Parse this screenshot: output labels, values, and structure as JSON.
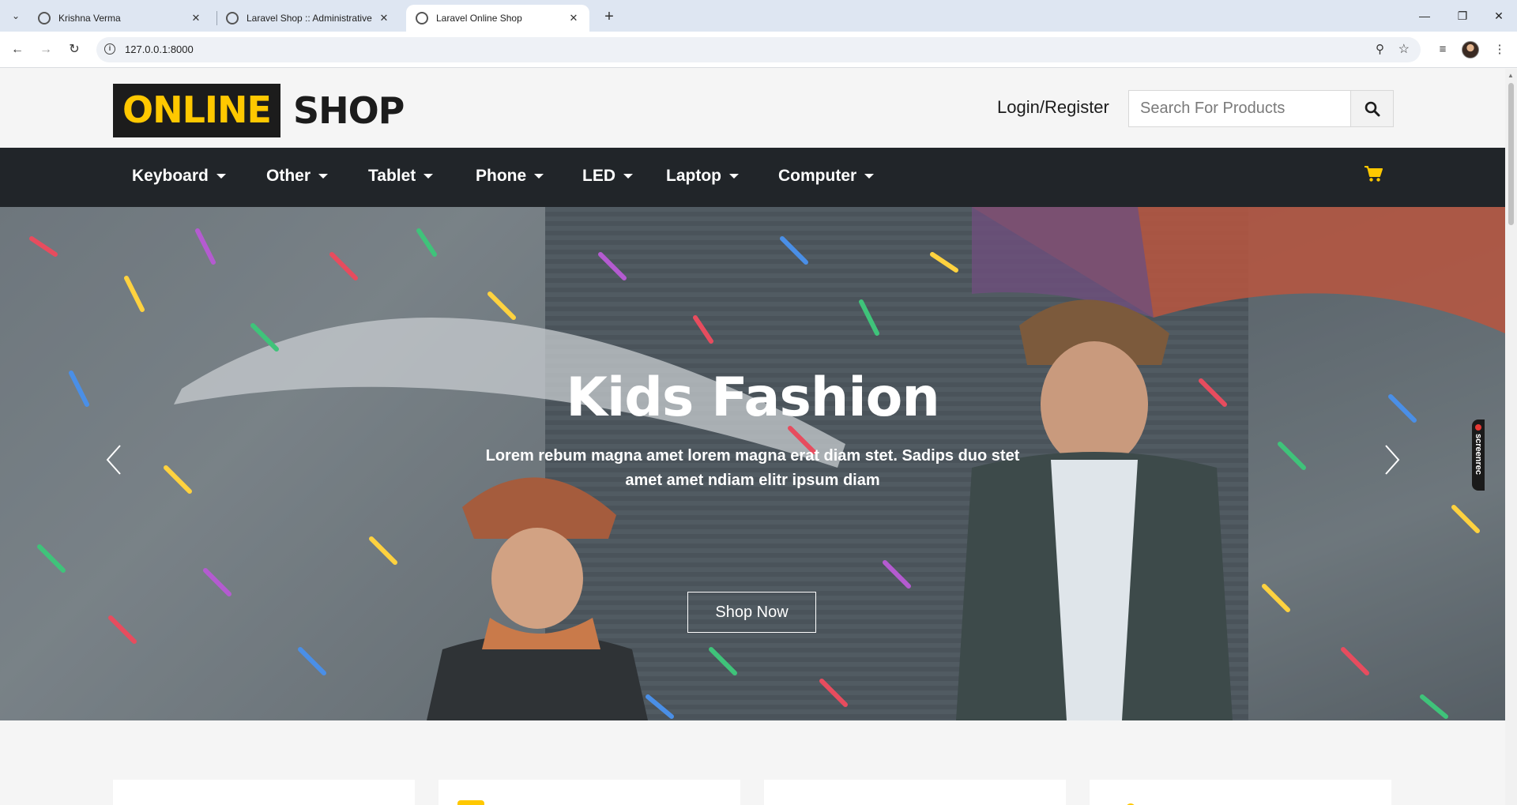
{
  "browser": {
    "tabs": [
      {
        "title": "Krishna Verma",
        "active": false
      },
      {
        "title": "Laravel Shop :: Administrative P",
        "active": false
      },
      {
        "title": "Laravel Online Shop",
        "active": true
      }
    ],
    "url": "127.0.0.1:8000"
  },
  "header": {
    "logo_highlight": "ONLINE",
    "logo_rest": "SHOP",
    "login_label": "Login/Register",
    "search_placeholder": "Search For Products"
  },
  "nav": {
    "items": [
      {
        "label": "Keyboard"
      },
      {
        "label": "Other"
      },
      {
        "label": "Tablet"
      },
      {
        "label": "Phone"
      },
      {
        "label": "LED"
      },
      {
        "label": "Laptop"
      },
      {
        "label": "Computer"
      }
    ],
    "cart_icon": "shopping-cart-icon",
    "accent_color": "#ffc800",
    "navbar_color": "#212529"
  },
  "hero": {
    "title": "Kids Fashion",
    "text": "Lorem rebum magna amet lorem magna erat diam stet. Sadips duo stet amet amet ndiam elitr ipsum diam",
    "button_label": "Shop Now"
  },
  "overlay": {
    "screenrec_label": "screenrec"
  }
}
